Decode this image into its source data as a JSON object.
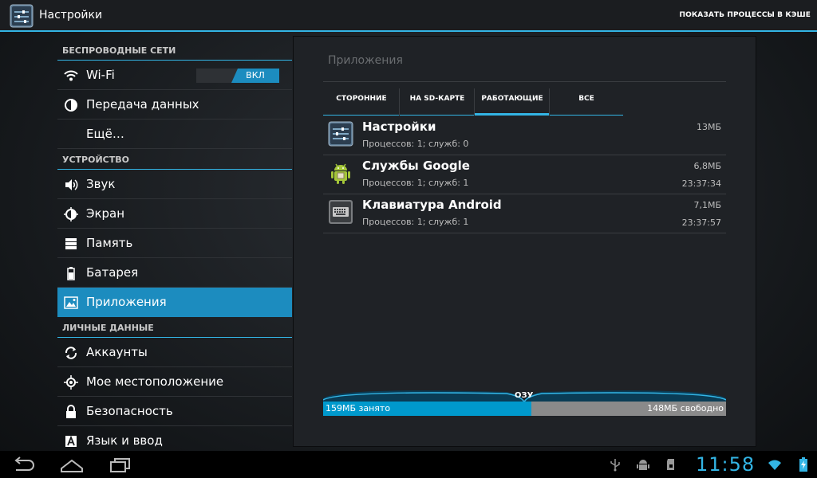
{
  "actionbar": {
    "title": "Настройки",
    "action": "ПОКАЗАТЬ ПРОЦЕССЫ В КЭШЕ"
  },
  "sidebar": {
    "sections": [
      {
        "header": "БЕСПРОВОДНЫЕ СЕТИ",
        "items": [
          {
            "label": "Wi-Fi",
            "icon": "wifi-icon",
            "toggle": "ВКЛ"
          },
          {
            "label": "Передача данных",
            "icon": "data-usage-icon"
          },
          {
            "label": "Ещё…",
            "icon": ""
          }
        ]
      },
      {
        "header": "УСТРОЙСТВО",
        "items": [
          {
            "label": "Звук",
            "icon": "sound-icon"
          },
          {
            "label": "Экран",
            "icon": "display-icon"
          },
          {
            "label": "Память",
            "icon": "storage-icon"
          },
          {
            "label": "Батарея",
            "icon": "battery-icon"
          },
          {
            "label": "Приложения",
            "icon": "apps-icon",
            "selected": true
          }
        ]
      },
      {
        "header": "ЛИЧНЫЕ ДАННЫЕ",
        "items": [
          {
            "label": "Аккаунты",
            "icon": "sync-icon"
          },
          {
            "label": "Мое местоположение",
            "icon": "location-icon"
          },
          {
            "label": "Безопасность",
            "icon": "lock-icon"
          },
          {
            "label": "Язык и ввод",
            "icon": "language-icon"
          }
        ]
      }
    ]
  },
  "panel": {
    "title": "Приложения",
    "tabs": [
      "СТОРОННИЕ",
      "НА SD-КАРТЕ",
      "РАБОТАЮЩИЕ",
      "ВСЕ"
    ],
    "active_tab": "РАБОТАЮЩИЕ",
    "processes": [
      {
        "name": "Настройки",
        "detail": "Процессов: 1; служб: 0",
        "size": "13МБ",
        "time": "",
        "icon": "settings-app-icon"
      },
      {
        "name": "Службы Google",
        "detail": "Процессов: 1; служб: 1",
        "size": "6,8МБ",
        "time": "23:37:34",
        "icon": "android-icon"
      },
      {
        "name": "Клавиатура Android",
        "detail": "Процессов: 1; служб: 1",
        "size": "7,1МБ",
        "time": "23:37:57",
        "icon": "keyboard-icon"
      }
    ],
    "ram": {
      "label": "ОЗУ",
      "used": "159МБ занято",
      "free": "148МБ свободно",
      "used_fraction": 0.516
    }
  },
  "systembar": {
    "clock": "11:58",
    "nav": [
      "back-icon",
      "home-icon",
      "recents-icon"
    ],
    "status_icons": [
      "usb-icon",
      "android-debug-icon",
      "sd-card-icon",
      "wifi-signal-icon",
      "battery-charging-icon"
    ]
  },
  "colors": {
    "accent": "#33b5e5",
    "selected": "#1c8cbf",
    "ram_used": "#0099cc",
    "ram_free": "#8a8a8a"
  }
}
